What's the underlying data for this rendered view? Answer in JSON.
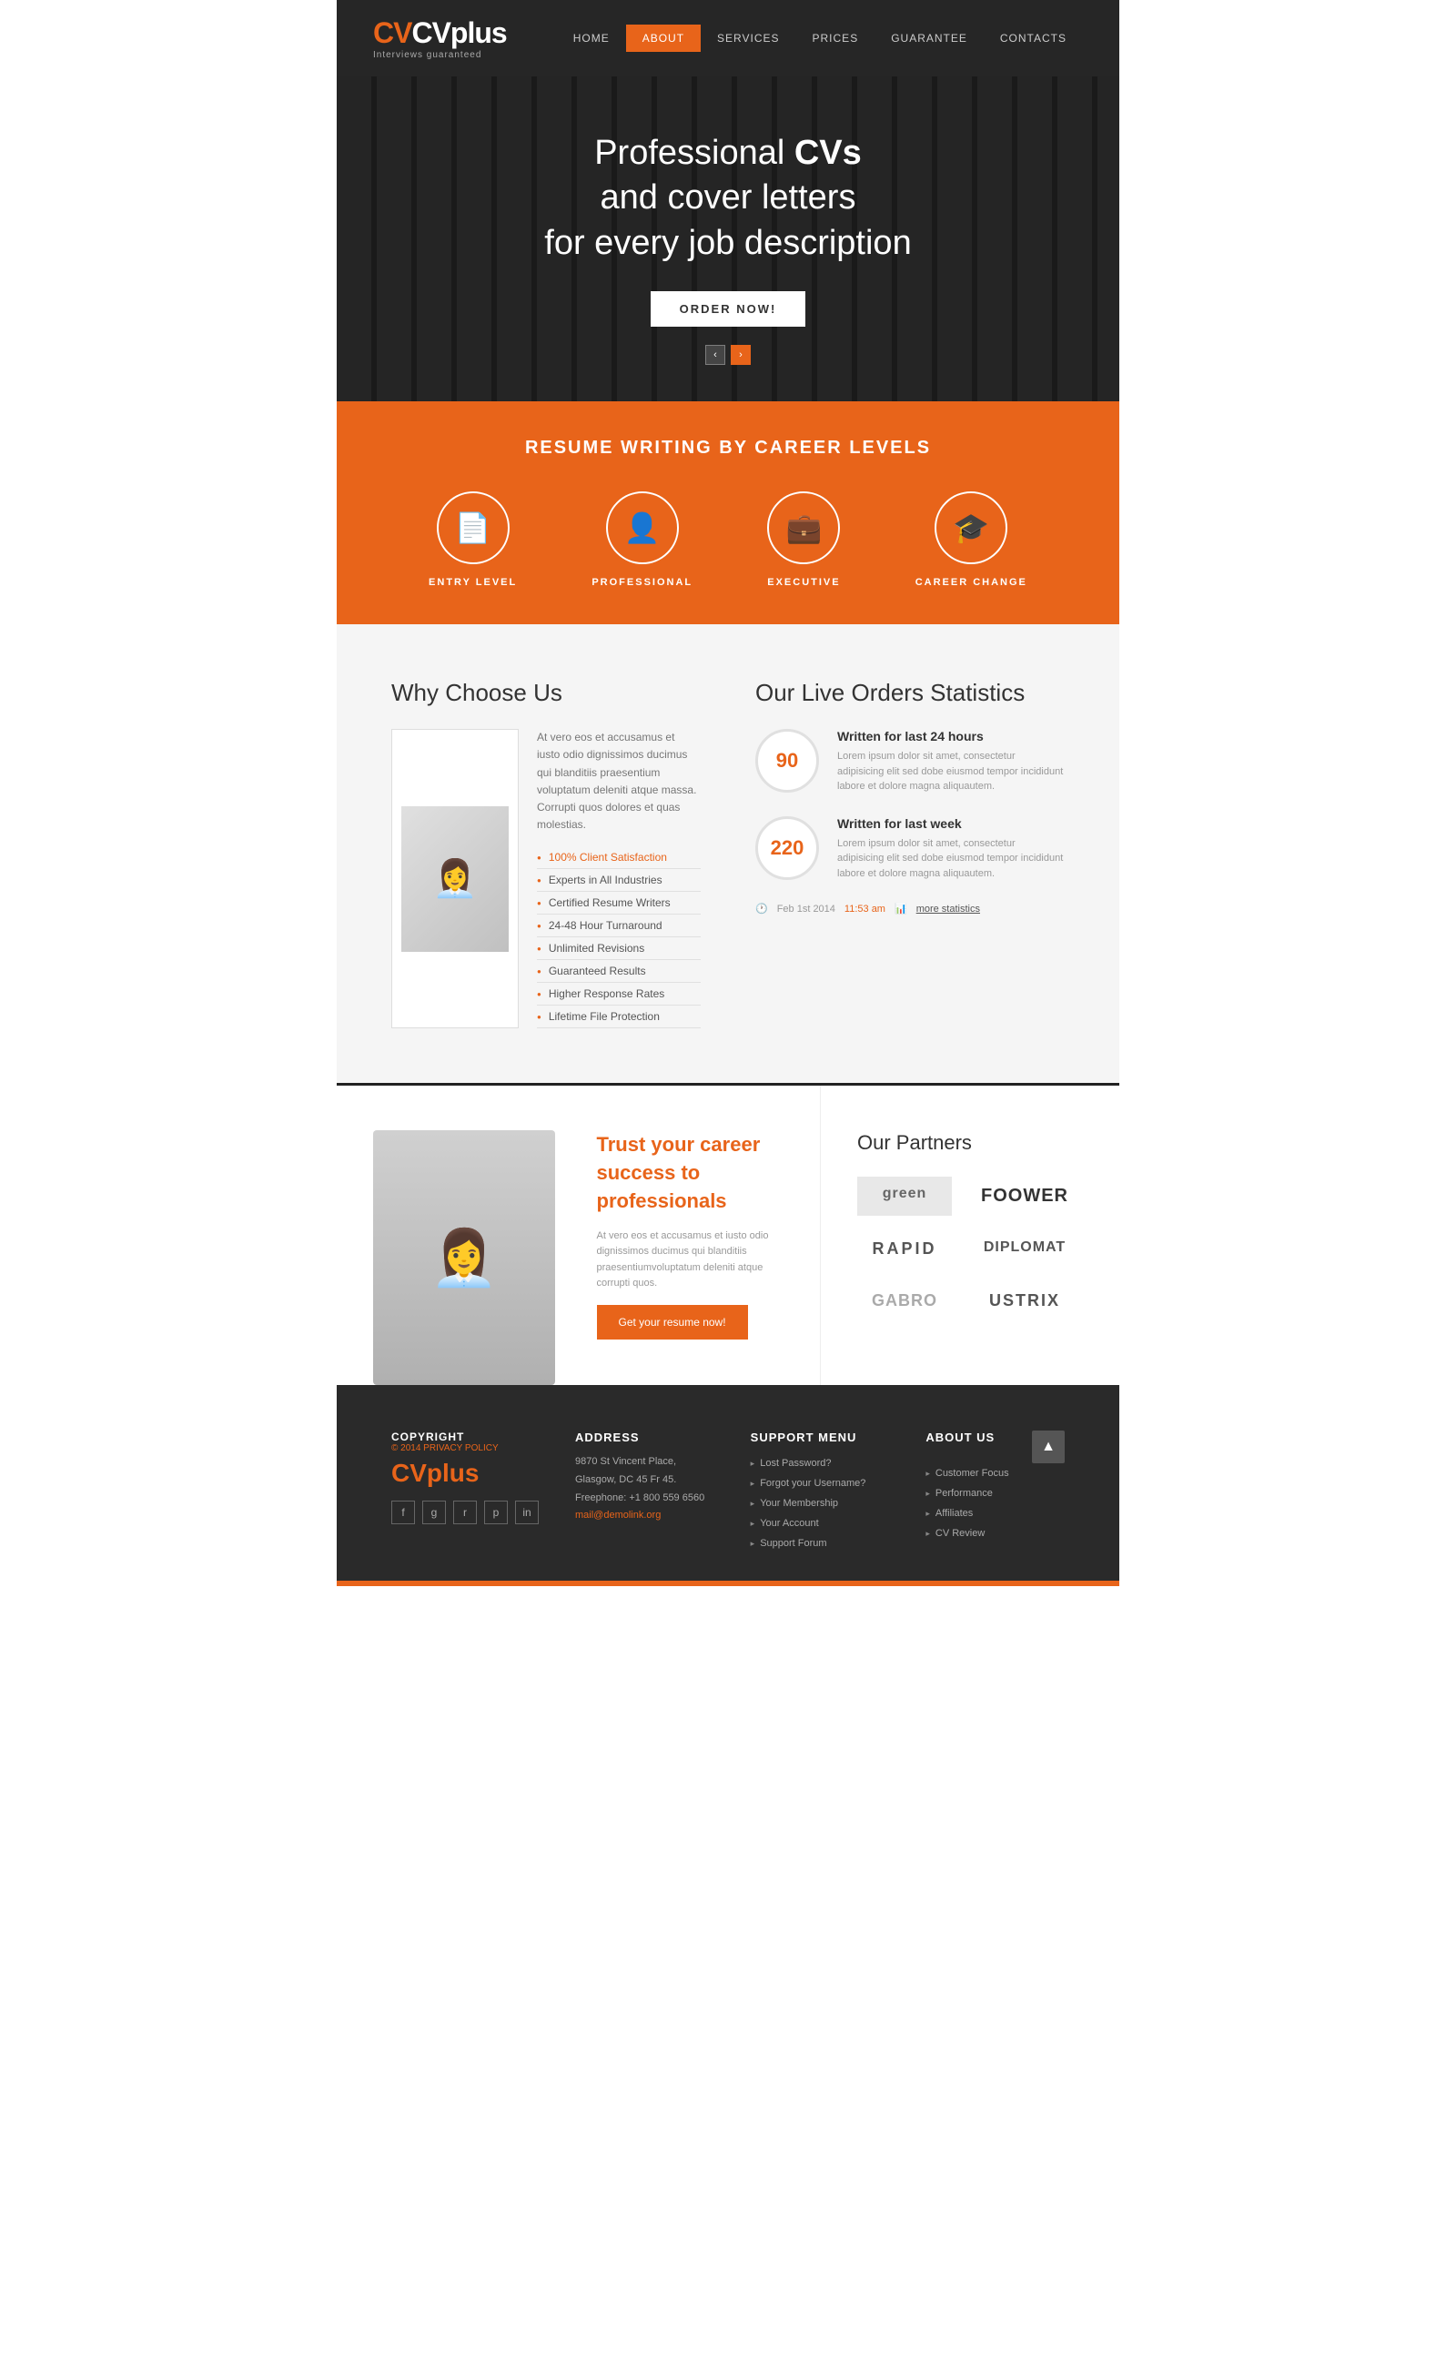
{
  "header": {
    "logo": "CVplus",
    "logo_accent": "CV",
    "logo_tagline": "Interviews guaranteed",
    "nav": [
      {
        "label": "HOME",
        "active": false
      },
      {
        "label": "ABOUT",
        "active": true
      },
      {
        "label": "SERVICES",
        "active": false
      },
      {
        "label": "PRICES",
        "active": false
      },
      {
        "label": "GUARANTEE",
        "active": false
      },
      {
        "label": "CONTACTS",
        "active": false
      }
    ]
  },
  "hero": {
    "title_line1": "Professional ",
    "title_bold": "CVs",
    "title_line2": "and cover letters",
    "title_line3": "for every job description",
    "cta_button": "ORDER NOW!",
    "slider_prev": "‹",
    "slider_next": "›"
  },
  "career": {
    "section_title": "RESUME WRITING BY CAREER LEVELS",
    "items": [
      {
        "label": "ENTRY LEVEL",
        "icon": "📄"
      },
      {
        "label": "PROFESSIONAL",
        "icon": "👤"
      },
      {
        "label": "EXECUTIVE",
        "icon": "💼"
      },
      {
        "label": "CAREER CHANGE",
        "icon": "🎓"
      }
    ]
  },
  "why_us": {
    "title": "Why Choose Us",
    "description": "At vero eos et accusamus et iusto odio dignissimos ducimus qui blanditiis praesentium voluptatum deleniti atque massa. Corrupti quos dolores et quas molestias.",
    "features": [
      {
        "label": "100% Client Satisfaction",
        "highlight": true
      },
      {
        "label": "Experts in All Industries",
        "highlight": false
      },
      {
        "label": "Certified Resume Writers",
        "highlight": false
      },
      {
        "label": "24-48 Hour Turnaround",
        "highlight": false
      },
      {
        "label": "Unlimited Revisions",
        "highlight": false
      },
      {
        "label": "Guaranteed Results",
        "highlight": false
      },
      {
        "label": "Higher Response Rates",
        "highlight": false
      },
      {
        "label": "Lifetime File Protection",
        "highlight": false
      }
    ]
  },
  "statistics": {
    "title": "Our Live Orders Statistics",
    "items": [
      {
        "count": "90",
        "label": "Written for last 24 hours",
        "desc": "Lorem ipsum dolor sit amet, consectetur adipisicing elit sed dobe eiusmod tempor incididunt labore et dolore magna aliquautem."
      },
      {
        "count": "220",
        "label": "Written for last week",
        "desc": "Lorem ipsum dolor sit amet, consectetur adipisicing elit sed dobe eiusmod tempor incididunt labore et dolore magna aliquautem."
      }
    ],
    "timestamp": "Feb 1st 2014",
    "time_orange": "11:53 am",
    "more_label": "more statistics"
  },
  "professionals": {
    "title_line1": "Trust your career",
    "title_line2": "success to",
    "title_accent": "professionals",
    "desc": "At vero eos et accusamus et iusto odio dignissimos ducimus qui blanditiis praesentiumvoluptatum deleniti atque corrupti quos.",
    "cta_button": "Get your resume now!"
  },
  "partners": {
    "title": "Our Partners",
    "logos": [
      {
        "label": "green",
        "style": "green"
      },
      {
        "label": "FOOWER",
        "style": "foower"
      },
      {
        "label": "RAPID",
        "style": "rapid"
      },
      {
        "label": "DIPLOMAT",
        "style": "diplomat"
      },
      {
        "label": "GABRO",
        "style": "gabro"
      },
      {
        "label": "USTRIX",
        "style": "ustrix"
      }
    ]
  },
  "footer": {
    "copyright_label": "COPYRIGHT",
    "copyright_sub": "© 2014 PRIVACY POLICY",
    "logo": "CVplus",
    "address_label": "Address",
    "address_lines": [
      "9870 St Vincent Place,",
      "Glasgow, DC 45 Fr 45.",
      "Freephone: +1 800 559 6560",
      "mail@demolink.org"
    ],
    "support_label": "Support Menu",
    "support_items": [
      "Lost Password?",
      "Forgot your Username?",
      "Your Membership",
      "Your Account",
      "Support Forum"
    ],
    "about_label": "About Us",
    "about_items": [
      "Customer Focus",
      "Performance",
      "Affiliates",
      "CV Review"
    ],
    "social_icons": [
      "f",
      "g+",
      "rss",
      "p",
      "in"
    ],
    "back_top": "▲"
  }
}
